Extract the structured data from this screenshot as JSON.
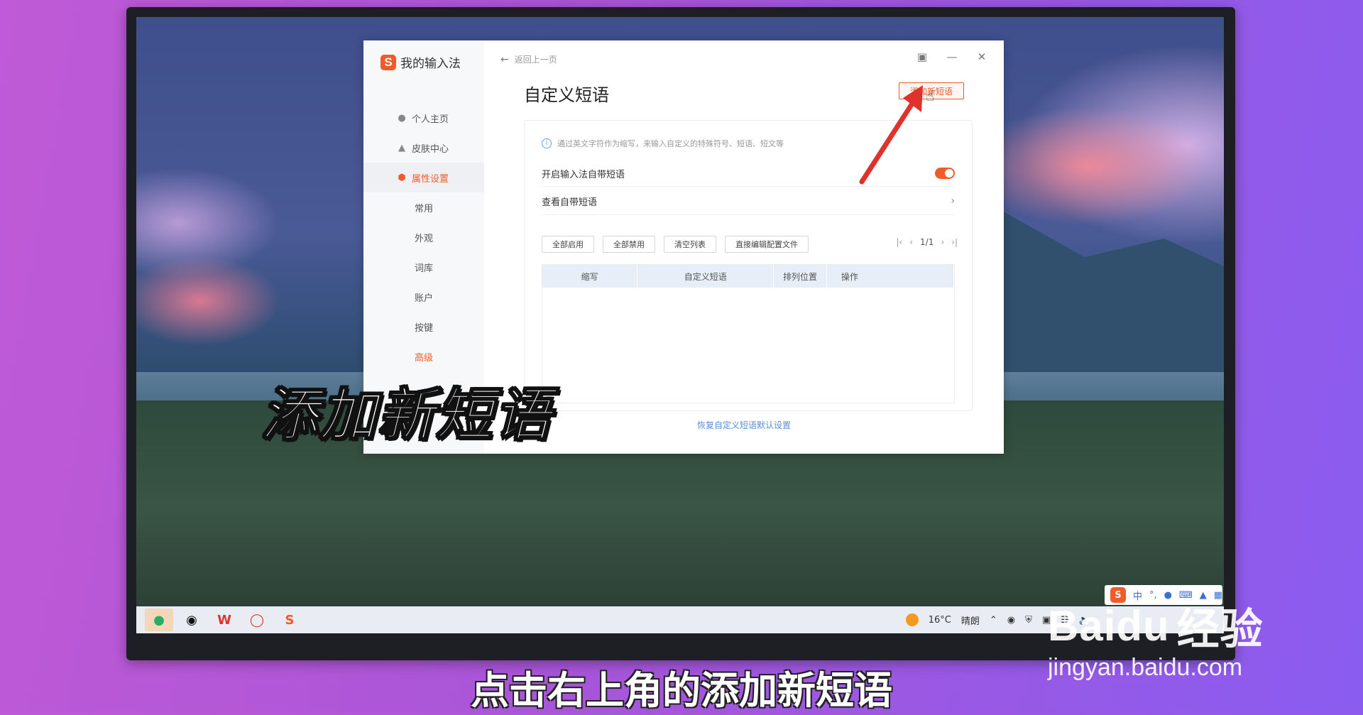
{
  "window": {
    "brand": "我的输入法",
    "back_label": "返回上一页",
    "page_title": "自定义短语",
    "add_button": "添加新短语"
  },
  "sidebar": {
    "items": [
      {
        "label": "个人主页",
        "icon": "user-icon"
      },
      {
        "label": "皮肤中心",
        "icon": "shirt-icon"
      },
      {
        "label": "属性设置",
        "icon": "settings-hex-icon",
        "active": true
      }
    ],
    "sub_items": [
      {
        "label": "常用"
      },
      {
        "label": "外观"
      },
      {
        "label": "词库"
      },
      {
        "label": "账户"
      },
      {
        "label": "按键"
      },
      {
        "label": "高级",
        "active": true
      }
    ]
  },
  "panel": {
    "tip": "通过英文字符作为缩写，来输入自定义的特殊符号、短语、短文等",
    "enable_label": "开启输入法自带短语",
    "enable_on": true,
    "view_label": "查看自带短语",
    "buttons": [
      "全部启用",
      "全部禁用",
      "清空列表",
      "直接编辑配置文件"
    ],
    "pager": "1/1",
    "columns": [
      "缩写",
      "自定义短语",
      "排列位置",
      "操作"
    ],
    "restore": "恢复自定义短语默认设置"
  },
  "overlay": {
    "caption": "添加新短语",
    "subtitle": "点击右上角的添加新短语"
  },
  "taskbar": {
    "weather_temp": "16°C",
    "weather_text": "晴朗"
  },
  "watermark": {
    "brand": "Baidu",
    "cn": "经验",
    "url": "jingyan.baidu.com"
  },
  "colors": {
    "accent": "#f15b2a",
    "link": "#5a8fd8"
  }
}
